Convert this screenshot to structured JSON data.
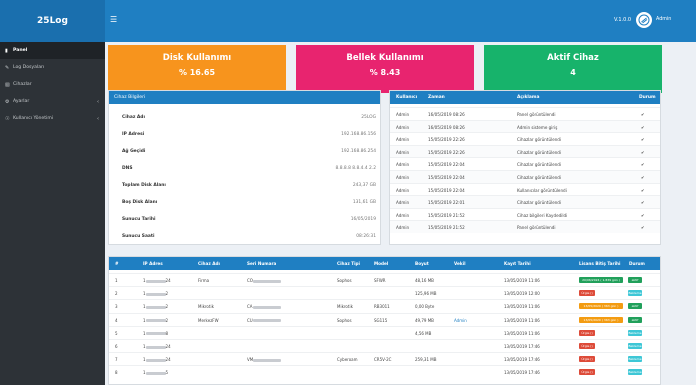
{
  "header": {
    "brand": "25Log",
    "menu_icon": "hamburger-icon",
    "version": "V.1.0.0",
    "user": "Admin"
  },
  "sidebar": {
    "items": [
      {
        "label": "Panel",
        "icon": "chart-icon",
        "active": true,
        "chevron": false
      },
      {
        "label": "Log Dosyaları",
        "icon": "edit-icon",
        "active": false,
        "chevron": false
      },
      {
        "label": "Cihazlar",
        "icon": "device-icon",
        "active": false,
        "chevron": false
      },
      {
        "label": "Ayarlar",
        "icon": "gear-icon",
        "active": false,
        "chevron": true
      },
      {
        "label": "Kullanıcı Yönetimi",
        "icon": "user-icon",
        "active": false,
        "chevron": true
      }
    ]
  },
  "stats": [
    {
      "title": "Disk Kullanımı",
      "value": "% 16.65",
      "color": "#f7941d"
    },
    {
      "title": "Bellek Kullanımı",
      "value": "% 8.43",
      "color": "#e8246f"
    },
    {
      "title": "Aktif Cihaz",
      "value": "4",
      "color": "#17b36b"
    }
  ],
  "device_info": {
    "title": "Cihaz Bilgileri",
    "rows": [
      {
        "key": "Cihaz Adı",
        "value": "25LOG"
      },
      {
        "key": "IP Adresi",
        "value": "192.168.86.156"
      },
      {
        "key": "Ağ Geçidi",
        "value": "192.168.86.254"
      },
      {
        "key": "DNS",
        "value": "8.8.8.8 8.8.4.4 2.2"
      },
      {
        "key": "Toplam Disk Alanı",
        "value": "243,37 GB"
      },
      {
        "key": "Boş Disk Alanı",
        "value": "131,61 GB"
      },
      {
        "key": "Sunucu Tarihi",
        "value": "16/05/2019"
      },
      {
        "key": "Sunucu Saati",
        "value": "08:26:31"
      }
    ]
  },
  "logs": {
    "headers": [
      "Kullanıcı",
      "Zaman",
      "Açıklama",
      "Durum"
    ],
    "rows": [
      {
        "user": "Admin",
        "time": "16/05/2019 08:26",
        "desc": "Panel görüntülendi"
      },
      {
        "user": "Admin",
        "time": "16/05/2019 08:26",
        "desc": "Admin sisteme giriş"
      },
      {
        "user": "Admin",
        "time": "15/05/2019 22:26",
        "desc": "Cihazlar görüntülendi"
      },
      {
        "user": "Admin",
        "time": "15/05/2019 22:26",
        "desc": "Cihazlar görüntülendi"
      },
      {
        "user": "Admin",
        "time": "15/05/2019 22:04",
        "desc": "Cihazlar görüntülendi"
      },
      {
        "user": "Admin",
        "time": "15/05/2019 22:04",
        "desc": "Cihazlar görüntülendi"
      },
      {
        "user": "Admin",
        "time": "15/05/2019 22:04",
        "desc": "Kullanıcılar görüntülendi"
      },
      {
        "user": "Admin",
        "time": "15/05/2019 22:01",
        "desc": "Cihazlar görüntülendi"
      },
      {
        "user": "Admin",
        "time": "15/05/2019 21:52",
        "desc": "Cihaz bilgileri Kaydedildi"
      },
      {
        "user": "Admin",
        "time": "15/05/2019 21:52",
        "desc": "Panel görüntülendi"
      }
    ],
    "status_icon": "check-icon"
  },
  "devices": {
    "headers": [
      "#",
      "IP Adres",
      "Cihaz Adı",
      "Seri Numara",
      "Cihaz Tipi",
      "Model",
      "Boyut",
      "Vekil",
      "Kayıt Tarihi",
      "Lisans Bitiş Tarihi",
      "Durum"
    ],
    "rows": [
      {
        "n": "1",
        "ip": "24",
        "name": "Firma",
        "serial": "CO",
        "type": "Sophos",
        "model": "SFWR",
        "size": "48,16 MB",
        "proxy": "",
        "date": "13/05/2019 11:06",
        "lic": "20/06/2024 ( 1.839 gün )",
        "lic_color": "#21a05b",
        "status": "aktif",
        "st_color": "#21a05b"
      },
      {
        "n": "2",
        "ip": "2",
        "name": "",
        "serial": "",
        "type": "",
        "model": "",
        "size": "125,96 MB",
        "proxy": "",
        "date": "13/05/2019 12:00",
        "lic": "Ürgle ()",
        "lic_color": "#dd4b39",
        "status": "Bekleme",
        "st_color": "#3ec7d6"
      },
      {
        "n": "3",
        "ip": "2",
        "name": "Mikrotik",
        "serial": "CA",
        "type": "Mikrotik",
        "model": "RB3011",
        "size": "0,00 Byte",
        "proxy": "",
        "date": "13/05/2019 11:06",
        "lic": "13/05/2020 ( 363 gün )",
        "lic_color": "#f39c12",
        "status": "aktif",
        "st_color": "#21a05b"
      },
      {
        "n": "4",
        "ip": "2",
        "name": "MerkezFW",
        "serial": "CU",
        "type": "Sophos",
        "model": "SG115",
        "size": "49,79 MB",
        "proxy": "Admin",
        "date": "13/05/2019 11:06",
        "lic": "13/05/2020 ( 363 gün )",
        "lic_color": "#f39c12",
        "status": "aktif",
        "st_color": "#21a05b"
      },
      {
        "n": "5",
        "ip": "8",
        "name": "",
        "serial": "",
        "type": "",
        "model": "",
        "size": "4,56 MB",
        "proxy": "",
        "date": "13/05/2019 11:06",
        "lic": "Ürgle ()",
        "lic_color": "#dd4b39",
        "status": "Bekleme",
        "st_color": "#3ec7d6"
      },
      {
        "n": "6",
        "ip": "24",
        "name": "",
        "serial": "",
        "type": "",
        "model": "",
        "size": "",
        "proxy": "",
        "date": "13/05/2019 17:46",
        "lic": "Ürgle ()",
        "lic_color": "#dd4b39",
        "status": "Bekleme",
        "st_color": "#3ec7d6"
      },
      {
        "n": "7",
        "ip": "24",
        "name": "",
        "serial": "VM",
        "type": "Cyberoam",
        "model": "CR5V-2C",
        "size": "259,31 MB",
        "proxy": "",
        "date": "13/05/2019 17:46",
        "lic": "Ürgle ()",
        "lic_color": "#dd4b39",
        "status": "Bekleme",
        "st_color": "#3ec7d6"
      },
      {
        "n": "8",
        "ip": "5",
        "name": "",
        "serial": "",
        "type": "",
        "model": "",
        "size": "",
        "proxy": "",
        "date": "13/05/2019 17:46",
        "lic": "Ürgle ()",
        "lic_color": "#dd4b39",
        "status": "Bekleme",
        "st_color": "#3ec7d6"
      }
    ]
  }
}
